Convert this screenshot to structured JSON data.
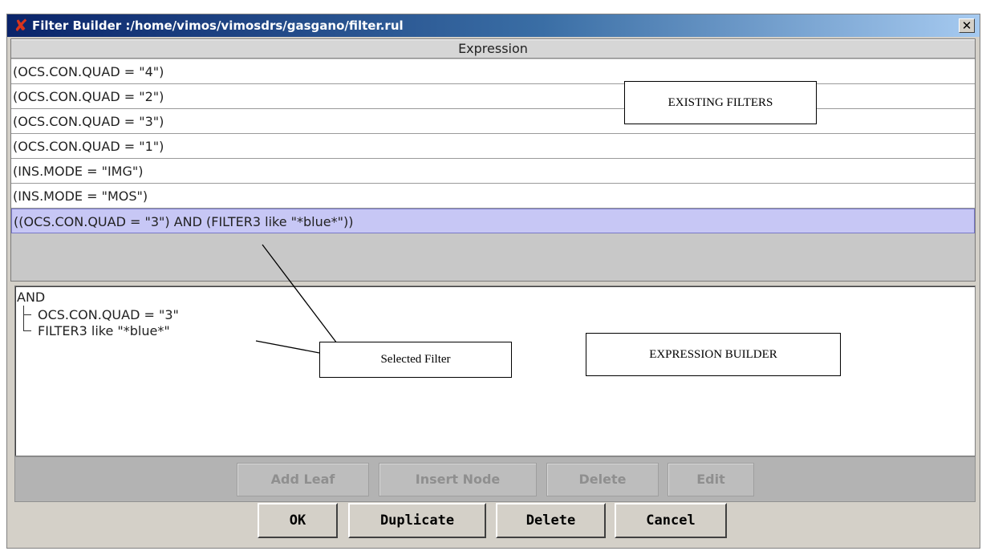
{
  "window": {
    "title": "Filter Builder :/home/vimos/vimosdrs/gasgano/filter.rul",
    "close_glyph": "✕",
    "app_icon": "x-mark-icon",
    "app_icon_color": "#d9341c"
  },
  "table": {
    "header": "Expression",
    "rows": [
      "(OCS.CON.QUAD = \"4\")",
      "(OCS.CON.QUAD = \"2\")",
      "(OCS.CON.QUAD = \"3\")",
      "(OCS.CON.QUAD = \"1\")",
      "(INS.MODE = \"IMG\")",
      "(INS.MODE = \"MOS\")",
      "((OCS.CON.QUAD = \"3\") AND (FILTER3 like \"*blue*\"))"
    ],
    "selected_index": 6,
    "selected_color": "#c7c7f5"
  },
  "tree": {
    "root": "AND",
    "children": [
      "OCS.CON.QUAD = \"3\"",
      "FILTER3 like \"*blue*\""
    ]
  },
  "builder_buttons": {
    "add_leaf": "Add Leaf",
    "insert_node": "Insert Node",
    "delete": "Delete",
    "edit": "Edit"
  },
  "dialog_buttons": {
    "ok": "OK",
    "duplicate": "Duplicate",
    "delete": "Delete",
    "cancel": "Cancel"
  },
  "annotations": {
    "existing_filters": "EXISTING FILTERS",
    "selected_filter": "Selected Filter",
    "expression_builder": "EXPRESSION BUILDER"
  }
}
